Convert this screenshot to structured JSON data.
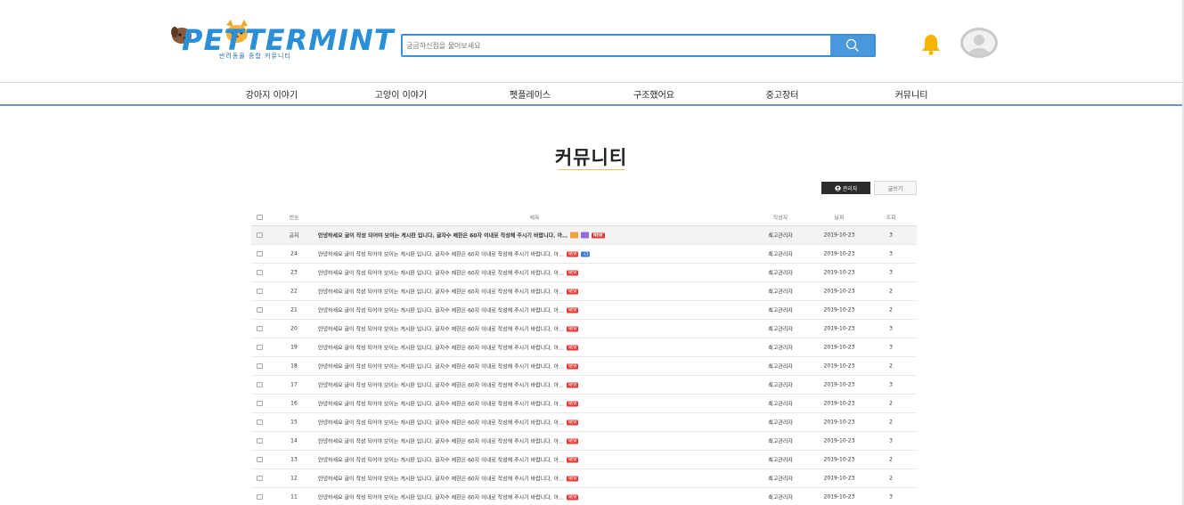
{
  "header": {
    "logo_text": "PETTERMINT",
    "logo_sub": "반려동물 종합 커뮤니티",
    "search_placeholder": "궁금하신점을 물어보세요"
  },
  "nav": [
    {
      "label": "강아지 이야기"
    },
    {
      "label": "고양이 이야기"
    },
    {
      "label": "펫플레이스"
    },
    {
      "label": "구조했어요"
    },
    {
      "label": "중고장터"
    },
    {
      "label": "커뮤니티"
    }
  ],
  "page": {
    "title": "커뮤니티",
    "admin_label": "관리자",
    "write_label": "글쓰기"
  },
  "table": {
    "columns": {
      "num": "번호",
      "title": "제목",
      "author": "작성자",
      "date": "날짜",
      "views": "조회"
    },
    "new_badge": "NEW",
    "rows": [
      {
        "num": "공지",
        "title": "안녕하세요 글이 작성 되어야 보이는 게시판 입니다. 글자수 제한은 60자 이내로 작성해 주시기 바랍니다. 아…",
        "author": "최고관리자",
        "date": "2019-10-23",
        "views": "3"
      },
      {
        "num": "24",
        "title": "안녕하세요 글이 작성 되어야 보이는 게시판 입니다. 글자수 제한은 60자 이내로 작성해 주시기 바랍니다. 아…",
        "comment_count": "+1",
        "author": "최고관리자",
        "date": "2019-10-23",
        "views": "3"
      },
      {
        "num": "23",
        "title": "안녕하세요 글이 작성 되어야 보이는 게시판 입니다. 글자수 제한은 60자 이내로 작성해 주시기 바랍니다. 아…",
        "author": "최고관리자",
        "date": "2019-10-23",
        "views": "3"
      },
      {
        "num": "22",
        "title": "안녕하세요 글이 작성 되어야 보이는 게시판 입니다. 글자수 제한은 60자 이내로 작성해 주시기 바랍니다. 아…",
        "author": "최고관리자",
        "date": "2019-10-23",
        "views": "2"
      },
      {
        "num": "21",
        "title": "안녕하세요 글이 작성 되어야 보이는 게시판 입니다. 글자수 제한은 60자 이내로 작성해 주시기 바랍니다. 아…",
        "author": "최고관리자",
        "date": "2019-10-23",
        "views": "2"
      },
      {
        "num": "20",
        "title": "안녕하세요 글이 작성 되어야 보이는 게시판 입니다. 글자수 제한은 60자 이내로 작성해 주시기 바랍니다. 아…",
        "author": "최고관리자",
        "date": "2019-10-23",
        "views": "3"
      },
      {
        "num": "19",
        "title": "안녕하세요 글이 작성 되어야 보이는 게시판 입니다. 글자수 제한은 60자 이내로 작성해 주시기 바랍니다. 아…",
        "author": "최고관리자",
        "date": "2019-10-23",
        "views": "3"
      },
      {
        "num": "18",
        "title": "안녕하세요 글이 작성 되어야 보이는 게시판 입니다. 글자수 제한은 60자 이내로 작성해 주시기 바랍니다. 아…",
        "author": "최고관리자",
        "date": "2019-10-23",
        "views": "2"
      },
      {
        "num": "17",
        "title": "안녕하세요 글이 작성 되어야 보이는 게시판 입니다. 글자수 제한은 60자 이내로 작성해 주시기 바랍니다. 아…",
        "author": "최고관리자",
        "date": "2019-10-23",
        "views": "3"
      },
      {
        "num": "16",
        "title": "안녕하세요 글이 작성 되어야 보이는 게시판 입니다. 글자수 제한은 60자 이내로 작성해 주시기 바랍니다. 아…",
        "author": "최고관리자",
        "date": "2019-10-23",
        "views": "2"
      },
      {
        "num": "15",
        "title": "안녕하세요 글이 작성 되어야 보이는 게시판 입니다. 글자수 제한은 60자 이내로 작성해 주시기 바랍니다. 아…",
        "author": "최고관리자",
        "date": "2019-10-23",
        "views": "2"
      },
      {
        "num": "14",
        "title": "안녕하세요 글이 작성 되어야 보이는 게시판 입니다. 글자수 제한은 60자 이내로 작성해 주시기 바랍니다. 아…",
        "author": "최고관리자",
        "date": "2019-10-23",
        "views": "3"
      },
      {
        "num": "13",
        "title": "안녕하세요 글이 작성 되어야 보이는 게시판 입니다. 글자수 제한은 60자 이내로 작성해 주시기 바랍니다. 아…",
        "author": "최고관리자",
        "date": "2019-10-23",
        "views": "2"
      },
      {
        "num": "12",
        "title": "안녕하세요 글이 작성 되어야 보이는 게시판 입니다. 글자수 제한은 60자 이내로 작성해 주시기 바랍니다. 아…",
        "author": "최고관리자",
        "date": "2019-10-23",
        "views": "2"
      },
      {
        "num": "11",
        "title": "안녕하세요 글이 작성 되어야 보이는 게시판 입니다. 글자수 제한은 60자 이내로 작성해 주시기 바랍니다. 아…",
        "author": "최고관리자",
        "date": "2019-10-23",
        "views": "3"
      }
    ]
  },
  "icons": {
    "search": "search-icon",
    "bell": "bell-icon",
    "avatar": "user-avatar-icon",
    "admin": "user-circle-icon",
    "image": "image-icon",
    "file": "file-icon"
  },
  "colors": {
    "brand_blue": "#2a8fd6",
    "search_border": "#3d8fd8",
    "nav_underline": "#6f94c4",
    "title_underline": "#e8c06a",
    "bell": "#f5b400",
    "new_badge": "#e53935",
    "count_badge": "#3f7fd0",
    "admin_button": "#2b2b2b"
  }
}
